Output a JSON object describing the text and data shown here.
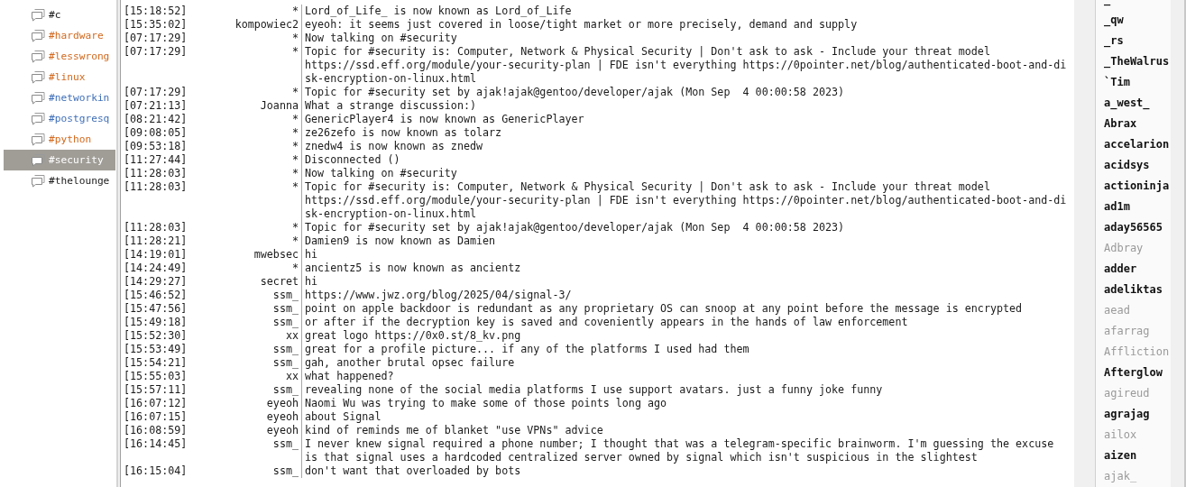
{
  "channels": [
    {
      "name": "#c",
      "color": "#1a1a1a",
      "selected": false
    },
    {
      "name": "#hardware",
      "color": "#d2691e",
      "selected": false
    },
    {
      "name": "#lesswrong",
      "color": "#d2691e",
      "selected": false
    },
    {
      "name": "#linux",
      "color": "#d2691e",
      "selected": false
    },
    {
      "name": "#networkin",
      "color": "#3f6fb8",
      "selected": false
    },
    {
      "name": "#postgresq",
      "color": "#3f6fb8",
      "selected": false
    },
    {
      "name": "#python",
      "color": "#d2691e",
      "selected": false
    },
    {
      "name": "#security",
      "color": "#ffffff",
      "selected": true
    },
    {
      "name": "#thelounge",
      "color": "#1a1a1a",
      "selected": false
    }
  ],
  "messages": [
    {
      "time": "[15:18:52]",
      "nick": "*",
      "text": "Lord_of_Life_ is now known as Lord_of_Life"
    },
    {
      "time": "[15:35:02]",
      "nick": "kompowiec2",
      "text": "eyeoh: it seems just covered in loose/tight market or more precisely, demand and supply"
    },
    {
      "time": "[07:17:29]",
      "nick": "*",
      "text": "Now talking on #security"
    },
    {
      "time": "[07:17:29]",
      "nick": "*",
      "text": "Topic for #security is: Computer, Network & Physical Security | Don't ask to ask - Include your threat model\nhttps://ssd.eff.org/module/your-security-plan | FDE isn't everything https://0pointer.net/blog/authenticated-boot-and-di\nsk-encryption-on-linux.html"
    },
    {
      "time": "[07:17:29]",
      "nick": "*",
      "text": "Topic for #security set by ajak!ajak@gentoo/developer/ajak (Mon Sep  4 00:00:58 2023)"
    },
    {
      "time": "[07:21:13]",
      "nick": "Joanna",
      "text": "What a strange discussion:)"
    },
    {
      "time": "[08:21:42]",
      "nick": "*",
      "text": "GenericPlayer4 is now known as GenericPlayer"
    },
    {
      "time": "[09:08:05]",
      "nick": "*",
      "text": "ze26zefo is now known as tolarz"
    },
    {
      "time": "[09:53:18]",
      "nick": "*",
      "text": "znedw4 is now known as znedw"
    },
    {
      "time": "[11:27:44]",
      "nick": "*",
      "text": "Disconnected ()"
    },
    {
      "time": "[11:28:03]",
      "nick": "*",
      "text": "Now talking on #security"
    },
    {
      "time": "[11:28:03]",
      "nick": "*",
      "text": "Topic for #security is: Computer, Network & Physical Security | Don't ask to ask - Include your threat model\nhttps://ssd.eff.org/module/your-security-plan | FDE isn't everything https://0pointer.net/blog/authenticated-boot-and-di\nsk-encryption-on-linux.html"
    },
    {
      "time": "[11:28:03]",
      "nick": "*",
      "text": "Topic for #security set by ajak!ajak@gentoo/developer/ajak (Mon Sep  4 00:00:58 2023)"
    },
    {
      "time": "[11:28:21]",
      "nick": "*",
      "text": "Damien9 is now known as Damien"
    },
    {
      "time": "[14:19:01]",
      "nick": "mwebsec",
      "text": "hi"
    },
    {
      "time": "[14:24:49]",
      "nick": "*",
      "text": "ancientz5 is now known as ancientz"
    },
    {
      "time": "[14:29:27]",
      "nick": "secret",
      "text": "hi"
    },
    {
      "time": "[15:46:52]",
      "nick": "ssm_",
      "text": "https://www.jwz.org/blog/2025/04/signal-3/"
    },
    {
      "time": "[15:47:56]",
      "nick": "ssm_",
      "text": "point on apple backdoor is redundant as any proprietary OS can snoop at any point before the message is encrypted"
    },
    {
      "time": "[15:49:18]",
      "nick": "ssm_",
      "text": "or after if the decryption key is saved and coveniently appears in the hands of law enforcement"
    },
    {
      "time": "[15:52:30]",
      "nick": "xx",
      "text": "great logo https://0x0.st/8_kv.png"
    },
    {
      "time": "[15:53:49]",
      "nick": "ssm_",
      "text": "great for a profile picture... if any of the platforms I used had them"
    },
    {
      "time": "[15:54:21]",
      "nick": "ssm_",
      "text": "gah, another brutal opsec failure"
    },
    {
      "time": "[15:55:03]",
      "nick": "xx",
      "text": "what happened?"
    },
    {
      "time": "[15:57:11]",
      "nick": "ssm_",
      "text": "revealing none of the social media platforms I use support avatars. just a funny joke funny"
    },
    {
      "time": "[16:07:12]",
      "nick": "eyeoh",
      "text": "Naomi Wu was trying to make some of those points long ago"
    },
    {
      "time": "[16:07:15]",
      "nick": "eyeoh",
      "text": "about Signal"
    },
    {
      "time": "[16:08:59]",
      "nick": "eyeoh",
      "text": "kind of reminds me of blanket \"use VPNs\" advice"
    },
    {
      "time": "[16:14:45]",
      "nick": "ssm_",
      "text": "I never knew signal required a phone number; I thought that was a telegram-specific brainworm. I'm guessing the excuse\nis that signal uses a hardcoded centralized server owned by signal which isn't suspicious in the slightest"
    },
    {
      "time": "[16:15:04]",
      "nick": "ssm_",
      "text": "don't want that overloaded by bots"
    }
  ],
  "users": [
    {
      "nick": "_",
      "away": false
    },
    {
      "nick": "_qw",
      "away": false
    },
    {
      "nick": "_rs",
      "away": false
    },
    {
      "nick": "_TheWalrus",
      "away": false
    },
    {
      "nick": "`Tim",
      "away": false
    },
    {
      "nick": "a_west_",
      "away": false
    },
    {
      "nick": "Abrax",
      "away": false
    },
    {
      "nick": "accelarion",
      "away": false
    },
    {
      "nick": "acidsys",
      "away": false
    },
    {
      "nick": "actioninja",
      "away": false
    },
    {
      "nick": "ad1m",
      "away": false
    },
    {
      "nick": "aday56565",
      "away": false
    },
    {
      "nick": "Adbray",
      "away": true
    },
    {
      "nick": "adder",
      "away": false
    },
    {
      "nick": "adeliktas",
      "away": false
    },
    {
      "nick": "aead",
      "away": true
    },
    {
      "nick": "afarrag",
      "away": true
    },
    {
      "nick": "Affliction",
      "away": true
    },
    {
      "nick": "Afterglow",
      "away": false
    },
    {
      "nick": "agireud",
      "away": true
    },
    {
      "nick": "agrajag",
      "away": false
    },
    {
      "nick": "ailox",
      "away": true
    },
    {
      "nick": "aizen",
      "away": false
    },
    {
      "nick": "ajak_",
      "away": true
    }
  ]
}
